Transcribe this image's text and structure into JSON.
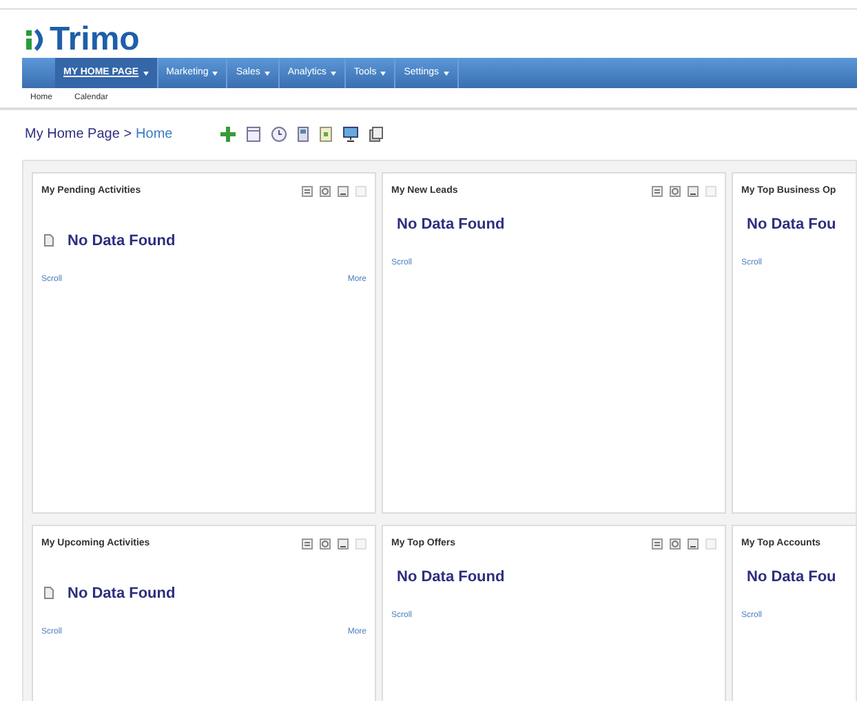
{
  "logo": {
    "text": "Trimo"
  },
  "nav": [
    {
      "label": "MY HOME PAGE",
      "selected": true
    },
    {
      "label": "Marketing",
      "selected": false
    },
    {
      "label": "Sales",
      "selected": false
    },
    {
      "label": "Analytics",
      "selected": false
    },
    {
      "label": "Tools",
      "selected": false
    },
    {
      "label": "Settings",
      "selected": false
    }
  ],
  "subnav": [
    {
      "label": "Home"
    },
    {
      "label": "Calendar"
    }
  ],
  "breadcrumb": {
    "parent": "My Home Page >",
    "current": "Home"
  },
  "panels": [
    {
      "title": "My Pending Activities",
      "message": "No Data Found",
      "kind": "activity",
      "tools": true,
      "scroll": "Scroll",
      "more": "More"
    },
    {
      "title": "My New Leads",
      "message": "No Data Found",
      "kind": "plain",
      "tools": true,
      "scroll": "Scroll"
    },
    {
      "title": "My Top Business Op",
      "message": "No Data Fou",
      "kind": "plain",
      "tools": false,
      "scroll": "Scroll"
    },
    {
      "title": "My Upcoming Activities",
      "message": "No Data Found",
      "kind": "activity",
      "tools": true,
      "scroll": "Scroll",
      "more": "More"
    },
    {
      "title": "My Top Offers",
      "message": "No Data Found",
      "kind": "plain",
      "tools": true,
      "scroll": "Scroll"
    },
    {
      "title": "My Top Accounts",
      "message": "No Data Fou",
      "kind": "plain",
      "tools": false,
      "scroll": "Scroll"
    }
  ]
}
